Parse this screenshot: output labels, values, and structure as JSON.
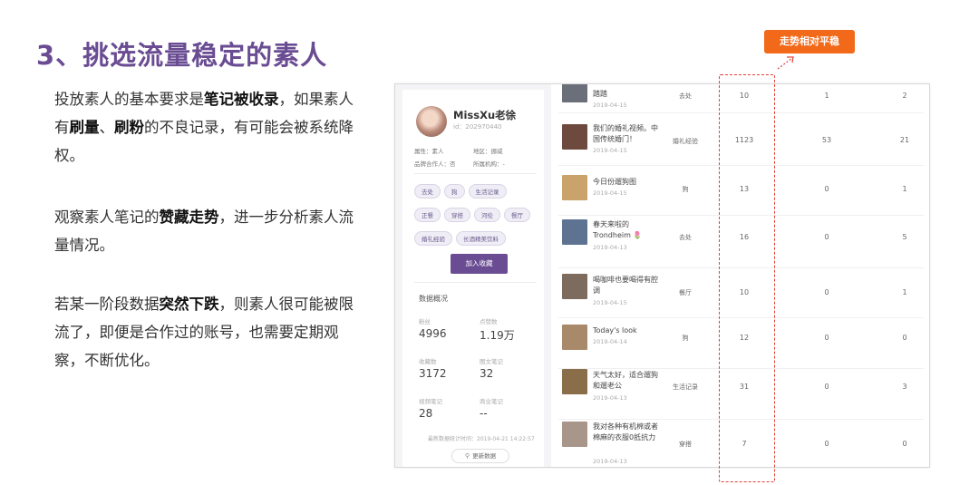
{
  "slide": {
    "title": "3、挑选流量稳定的素人",
    "paragraph1": {
      "t1": "投放素人的基本要求是",
      "b1": "笔记被收录",
      "t2": "，如果素人有",
      "b2": "刷量",
      "t3": "、",
      "b3": "刷粉",
      "t4": "的不良记录，有可能会被系统降权。"
    },
    "paragraph2": {
      "t1": "观察素人笔记的",
      "b1": "赞藏走势",
      "t2": "，进一步分析素人流量情况。"
    },
    "paragraph3": {
      "t1": "若某一阶段数据",
      "b1": "突然下跌",
      "t2": "，则素人很可能被限流了，即便是合作过的账号，也需要定期观察，不断优化。"
    },
    "callout": "走势相对平稳"
  },
  "profile": {
    "name": "MissXu老徐",
    "id": "id：202970440",
    "attrs": {
      "type": "属性：素人",
      "region": "地区：挪威",
      "brand": "品牌合作人：否",
      "org": "所属机构：-"
    },
    "tags": [
      "去处",
      "狗",
      "生活记录",
      "正餐",
      "穿搭",
      "河伦",
      "餐厅",
      "婚礼经验",
      "长酒精美饮料"
    ],
    "collect_button": "加入收藏",
    "stats_title": "数据概况",
    "stats": [
      {
        "label": "粉丝",
        "value": "4996"
      },
      {
        "label": "点赞数",
        "value": "1.19万"
      },
      {
        "label": "收藏数",
        "value": "3172"
      },
      {
        "label": "图文笔记",
        "value": "32"
      },
      {
        "label": "视频笔记",
        "value": "28"
      },
      {
        "label": "商业笔记",
        "value": "--"
      }
    ],
    "update_time": "最新数据统计时间：2019-04-21 14:22:57",
    "refresh_button": "更新数据",
    "refresh_icon": "search-icon"
  },
  "notes": [
    {
      "title": "踏踏",
      "date": "2019-04-15",
      "category": "去处",
      "likes": "10",
      "collects": "1",
      "comments": "2",
      "thumb_color": "#6b6f7a"
    },
    {
      "title": "我们的婚礼视频。中国传统婚门！",
      "date": "2019-04-15",
      "category": "婚礼经验",
      "likes": "1123",
      "collects": "53",
      "comments": "21",
      "thumb_color": "#6e4a3e"
    },
    {
      "title": "今日份遛狗图",
      "date": "2019-04-15",
      "category": "狗",
      "likes": "13",
      "collects": "0",
      "comments": "1",
      "thumb_color": "#c9a36b"
    },
    {
      "title": "春天来啦的Trondheim 🌷",
      "date": "2019-04-13",
      "category": "去处",
      "likes": "16",
      "collects": "0",
      "comments": "5",
      "thumb_color": "#5d7391"
    },
    {
      "title": "喝咖啡也要喝得有腔调",
      "date": "2019-04-15",
      "category": "餐厅",
      "likes": "10",
      "collects": "0",
      "comments": "1",
      "thumb_color": "#7d6c5e"
    },
    {
      "title": "Today's look",
      "date": "2019-04-14",
      "category": "狗",
      "likes": "12",
      "collects": "0",
      "comments": "0",
      "thumb_color": "#a88a6a"
    },
    {
      "title": "天气太好，适合遛狗和遛老公",
      "date": "2019-04-13",
      "category": "生活记录",
      "likes": "31",
      "collects": "0",
      "comments": "3",
      "thumb_color": "#8a6e4a"
    },
    {
      "title": "我对各种有机棉或者棉麻的衣服0抵抗力",
      "date": "2019-04-13",
      "category": "穿搭",
      "likes": "7",
      "collects": "0",
      "comments": "0",
      "thumb_color": "#a9968a"
    }
  ],
  "colors": {
    "accent_purple": "#6a4c93",
    "callout_orange": "#f2691a",
    "dash_red": "#e0403a"
  }
}
